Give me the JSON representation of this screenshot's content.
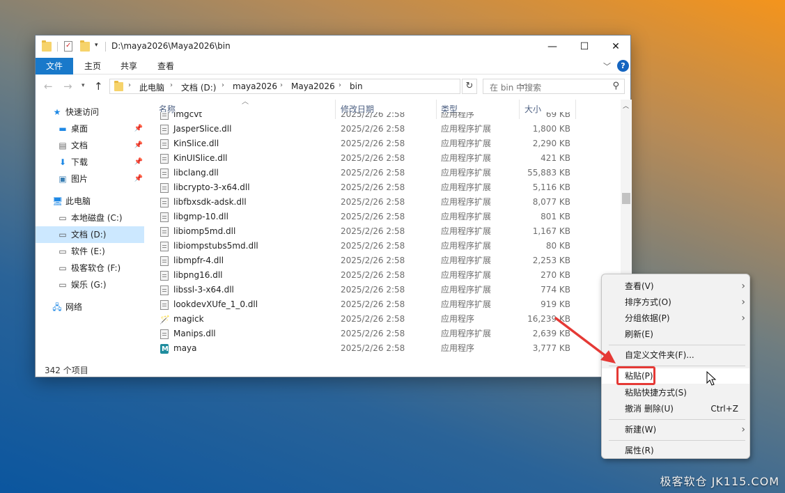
{
  "window": {
    "title_path": "D:\\maya2026\\Maya2026\\bin",
    "controls": {
      "minimize": "—",
      "maximize": "☐",
      "close": "✕"
    }
  },
  "ribbon": {
    "tabs": [
      "文件",
      "主页",
      "共享",
      "查看"
    ],
    "help_label": "?"
  },
  "address": {
    "crumbs": [
      "此电脑",
      "文档 (D:)",
      "maya2026",
      "Maya2026",
      "bin"
    ]
  },
  "search": {
    "placeholder": "在 bin 中搜索"
  },
  "sidebar": {
    "items": [
      {
        "label": "快速访问",
        "icon": "star-icon",
        "pinned": false
      },
      {
        "label": "桌面",
        "icon": "desktop-icon",
        "pinned": true
      },
      {
        "label": "文档",
        "icon": "document-icon",
        "pinned": true
      },
      {
        "label": "下载",
        "icon": "download-icon",
        "pinned": true
      },
      {
        "label": "图片",
        "icon": "picture-icon",
        "pinned": true
      },
      {
        "label": "此电脑",
        "icon": "computer-icon",
        "pinned": false
      },
      {
        "label": "本地磁盘 (C:)",
        "icon": "drive-icon",
        "pinned": false
      },
      {
        "label": "文档 (D:)",
        "icon": "drive-icon",
        "pinned": false,
        "selected": true
      },
      {
        "label": "软件 (E:)",
        "icon": "drive-icon",
        "pinned": false
      },
      {
        "label": "极客软仓 (F:)",
        "icon": "drive-icon",
        "pinned": false
      },
      {
        "label": "娱乐 (G:)",
        "icon": "drive-icon",
        "pinned": false
      },
      {
        "label": "网络",
        "icon": "network-icon",
        "pinned": false
      }
    ]
  },
  "columns": {
    "name": "名称",
    "date": "修改日期",
    "type": "类型",
    "size": "大小"
  },
  "files": [
    {
      "name": "imgcvt",
      "date": "2025/2/26 2:58",
      "type": "应用程序",
      "size": "69 KB",
      "icon": "app"
    },
    {
      "name": "JasperSlice.dll",
      "date": "2025/2/26 2:58",
      "type": "应用程序扩展",
      "size": "1,800 KB",
      "icon": "dll"
    },
    {
      "name": "KinSlice.dll",
      "date": "2025/2/26 2:58",
      "type": "应用程序扩展",
      "size": "2,290 KB",
      "icon": "dll"
    },
    {
      "name": "KinUISlice.dll",
      "date": "2025/2/26 2:58",
      "type": "应用程序扩展",
      "size": "421 KB",
      "icon": "dll"
    },
    {
      "name": "libclang.dll",
      "date": "2025/2/26 2:58",
      "type": "应用程序扩展",
      "size": "55,883 KB",
      "icon": "dll"
    },
    {
      "name": "libcrypto-3-x64.dll",
      "date": "2025/2/26 2:58",
      "type": "应用程序扩展",
      "size": "5,116 KB",
      "icon": "dll"
    },
    {
      "name": "libfbxsdk-adsk.dll",
      "date": "2025/2/26 2:58",
      "type": "应用程序扩展",
      "size": "8,077 KB",
      "icon": "dll"
    },
    {
      "name": "libgmp-10.dll",
      "date": "2025/2/26 2:58",
      "type": "应用程序扩展",
      "size": "801 KB",
      "icon": "dll"
    },
    {
      "name": "libiomp5md.dll",
      "date": "2025/2/26 2:58",
      "type": "应用程序扩展",
      "size": "1,167 KB",
      "icon": "dll"
    },
    {
      "name": "libiompstubs5md.dll",
      "date": "2025/2/26 2:58",
      "type": "应用程序扩展",
      "size": "80 KB",
      "icon": "dll"
    },
    {
      "name": "libmpfr-4.dll",
      "date": "2025/2/26 2:58",
      "type": "应用程序扩展",
      "size": "2,253 KB",
      "icon": "dll"
    },
    {
      "name": "libpng16.dll",
      "date": "2025/2/26 2:58",
      "type": "应用程序扩展",
      "size": "270 KB",
      "icon": "dll"
    },
    {
      "name": "libssl-3-x64.dll",
      "date": "2025/2/26 2:58",
      "type": "应用程序扩展",
      "size": "774 KB",
      "icon": "dll"
    },
    {
      "name": "lookdevXUfe_1_0.dll",
      "date": "2025/2/26 2:58",
      "type": "应用程序扩展",
      "size": "919 KB",
      "icon": "dll"
    },
    {
      "name": "magick",
      "date": "2025/2/26 2:58",
      "type": "应用程序",
      "size": "16,239 KB",
      "icon": "magick"
    },
    {
      "name": "Manips.dll",
      "date": "2025/2/26 2:58",
      "type": "应用程序扩展",
      "size": "2,639 KB",
      "icon": "dll"
    },
    {
      "name": "maya",
      "date": "2025/2/26 2:58",
      "type": "应用程序",
      "size": "3,777 KB",
      "icon": "maya"
    }
  ],
  "status": {
    "count": "342 个项目"
  },
  "context_menu": {
    "items": [
      {
        "label": "查看(V)",
        "submenu": true
      },
      {
        "label": "排序方式(O)",
        "submenu": true
      },
      {
        "label": "分组依据(P)",
        "submenu": true
      },
      {
        "label": "刷新(E)"
      },
      {
        "sep": true
      },
      {
        "label": "自定义文件夹(F)..."
      },
      {
        "sep": true
      },
      {
        "label": "粘贴(P)",
        "highlighted": true
      },
      {
        "label": "粘贴快捷方式(S)"
      },
      {
        "label": "撤消 删除(U)",
        "shortcut": "Ctrl+Z"
      },
      {
        "sep": true
      },
      {
        "label": "新建(W)",
        "submenu": true
      },
      {
        "sep": true
      },
      {
        "label": "属性(R)"
      }
    ]
  },
  "watermark": "极客软仓 JK115.COM",
  "accent_color": "#1979ca",
  "annotation_color": "#e53935"
}
